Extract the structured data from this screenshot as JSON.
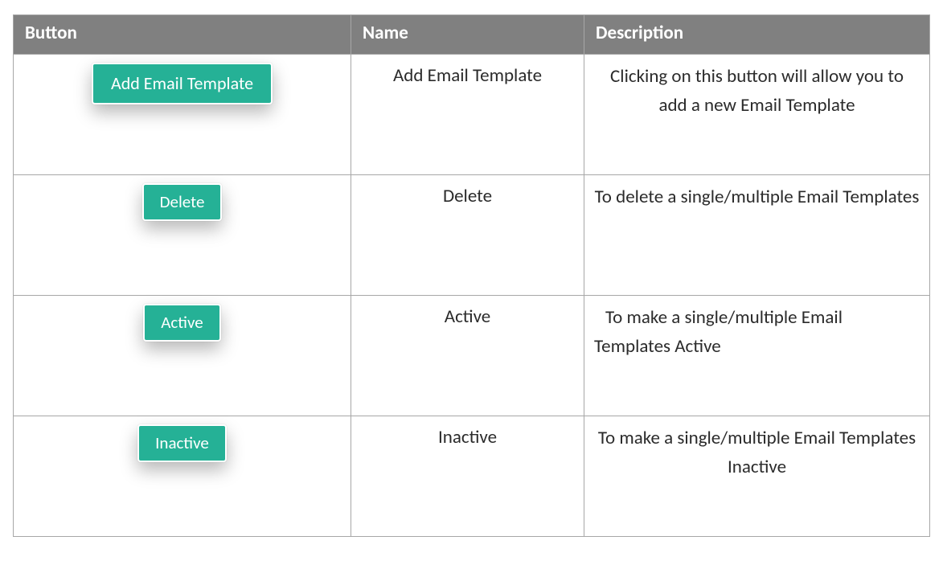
{
  "headers": {
    "button": "Button",
    "name": "Name",
    "desc": "Description"
  },
  "rows": [
    {
      "button_label": "Add Email Template",
      "button_size": "large",
      "name": "Add Email Template",
      "desc": "Clicking on this button will allow you to add a new Email Template",
      "desc_align": "center"
    },
    {
      "button_label": "Delete",
      "button_size": "small",
      "name": "Delete",
      "desc": "To delete a single/multiple Email Templates",
      "desc_align": "center"
    },
    {
      "button_label": "Active",
      "button_size": "small",
      "name": "Active",
      "desc": "To make a single/multiple Email Templates Active",
      "desc_align": "left"
    },
    {
      "button_label": "Inactive",
      "button_size": "small",
      "name": "Inactive",
      "desc": "To make a single/multiple Email Templates Inactive",
      "desc_align": "center"
    }
  ]
}
